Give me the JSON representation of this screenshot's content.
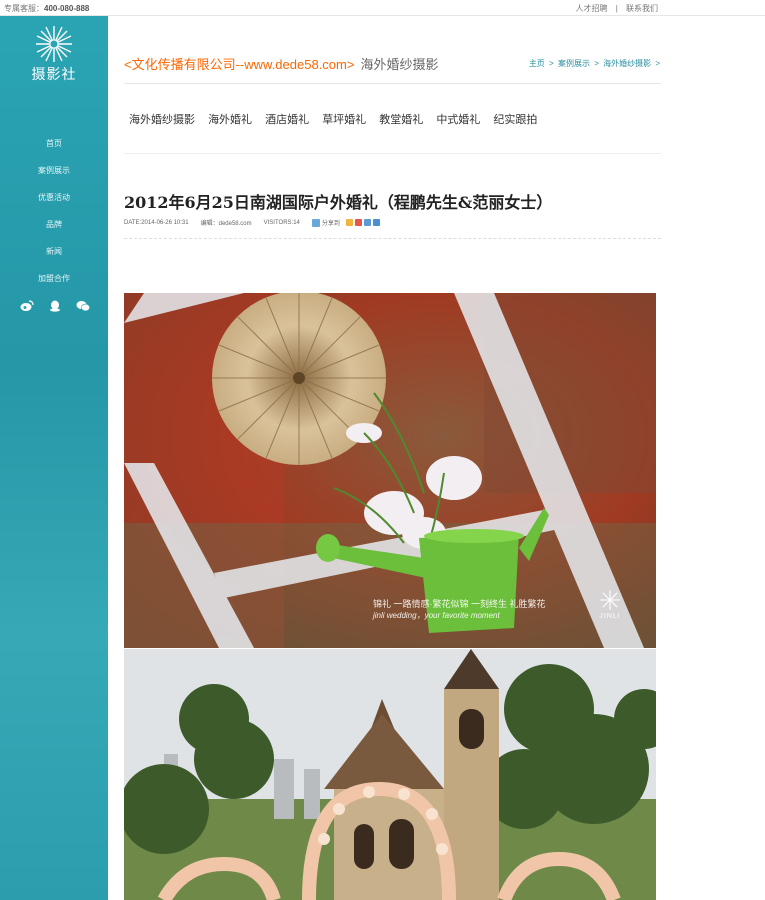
{
  "topbar": {
    "hotline_label": "专属客服：",
    "hotline_number": "400-080-888",
    "links": [
      "人才招聘",
      "|",
      "联系我们"
    ]
  },
  "logo": {
    "text": "摄影社"
  },
  "nav": {
    "items": [
      "首页",
      "案例展示",
      "优惠活动",
      "品牌",
      "新闻",
      "加盟合作"
    ]
  },
  "social": {
    "icons": [
      "weibo-icon",
      "qq-icon",
      "wechat-icon"
    ]
  },
  "header": {
    "site_title": "<文化传播有限公司--www.dede58.com>",
    "section": "海外婚纱摄影",
    "breadcrumb": [
      "主页",
      ">",
      "案例展示",
      ">",
      "海外婚纱摄影",
      ">"
    ]
  },
  "categories": [
    "海外婚纱摄影",
    "海外婚礼",
    "酒店婚礼",
    "草坪婚礼",
    "教堂婚礼",
    "中式婚礼",
    "纪实跟拍"
  ],
  "article": {
    "title": "2012年6月25日南湖国际户外婚礼（程鹏先生&范丽女士）",
    "date": "DATE:2014-06-26 10:31",
    "editor": "编辑：dede58.com",
    "visitors": "VISITORS:14",
    "share_label": "分享到"
  },
  "photo1": {
    "watermark_line1": "锦礼  一路情感·繁花似锦  一刻终生  礼胜繁花",
    "watermark_line2": "jinli wedding，your favorite moment",
    "watermark_brand": "JINLI"
  },
  "colors": {
    "sidebar": "#2aa4b3",
    "accent": "#ff6600",
    "link": "#2b8fa0"
  }
}
